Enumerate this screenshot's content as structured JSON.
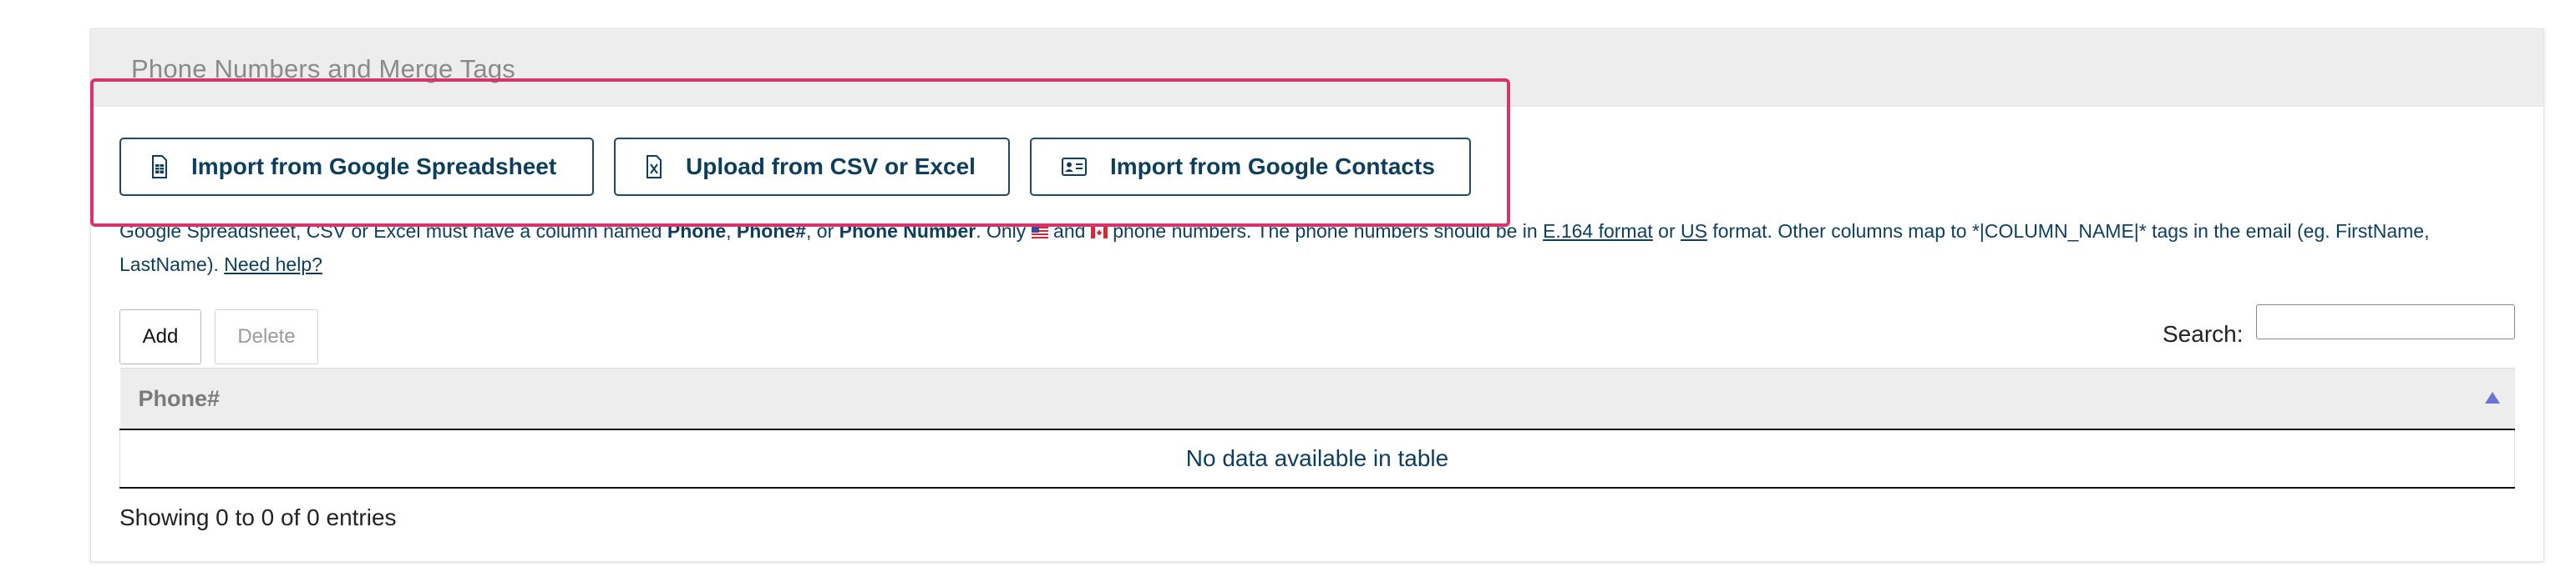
{
  "panel": {
    "title": "Phone Numbers and Merge Tags"
  },
  "import_buttons": [
    {
      "label": "Import from Google Spreadsheet",
      "icon": "spreadsheet-icon"
    },
    {
      "label": "Upload from CSV or Excel",
      "icon": "excel-file-icon"
    },
    {
      "label": "Import from Google Contacts",
      "icon": "contact-card-icon"
    }
  ],
  "help": {
    "t1": "Google Spreadsheet, CSV or Excel must have a column named ",
    "col1": "Phone",
    "sep1": ", ",
    "col2": "Phone#",
    "sep2": ", or ",
    "col3": "Phone Number",
    "t2": ". Only ",
    "t3": " and ",
    "t4": " phone numbers. The phone numbers should be in ",
    "link_e164": "E.164 format",
    "t5": " or ",
    "link_us": "US",
    "t6": " format. Other columns map to *|COLUMN_NAME|* tags in the email (eg. FirstName, LastName). ",
    "link_help": "Need help?"
  },
  "table_controls": {
    "add_label": "Add",
    "delete_label": "Delete",
    "search_label": "Search:",
    "search_value": ""
  },
  "table": {
    "columns": [
      "Phone#"
    ],
    "empty_message": "No data available in table",
    "info": "Showing 0 to 0 of 0 entries"
  },
  "colors": {
    "accent": "#0c3e5e",
    "highlight_border": "#d8336a",
    "sort_arrow": "#6a74d8"
  }
}
